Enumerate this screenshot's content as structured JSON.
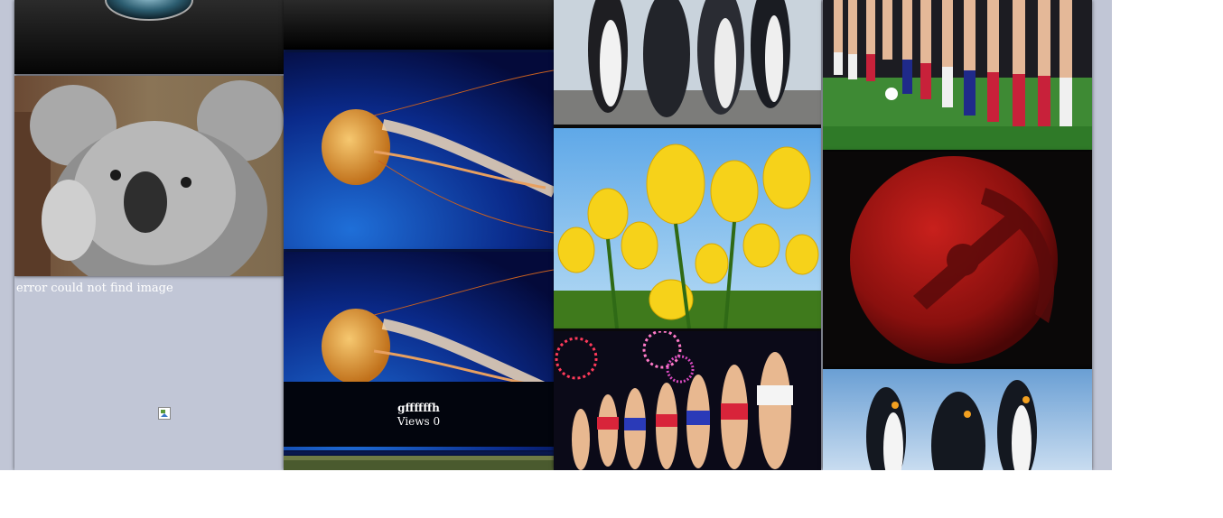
{
  "gallery": {
    "column1": {
      "tile_top": {
        "subject": "logo-orb"
      },
      "tile_koala": {
        "subject": "koala"
      },
      "error_text": "error could not find image"
    },
    "column2": {
      "tile_top": {
        "subject": "dark-panel"
      },
      "tile_jelly1": {
        "subject": "jellyfish"
      },
      "tile_jelly2": {
        "subject": "jellyfish"
      },
      "caption": {
        "title": "gffffffh",
        "views": "Views 0"
      },
      "tile_bottom": {
        "subject": "landscape"
      }
    },
    "column3": {
      "tile_penguins": {
        "subject": "penguins"
      },
      "tile_tulips": {
        "subject": "yellow-tulips"
      },
      "tile_fireworks": {
        "subject": "fireworks-models"
      }
    },
    "column4": {
      "tile_legs": {
        "subject": "soccer-legs"
      },
      "tile_moon": {
        "subject": "red-moon"
      },
      "tile_penguins2": {
        "subject": "king-penguins"
      }
    }
  },
  "colors": {
    "board_bg": "#c1c6d6",
    "caption_bg": "#02050d",
    "text": "#ffffff"
  }
}
